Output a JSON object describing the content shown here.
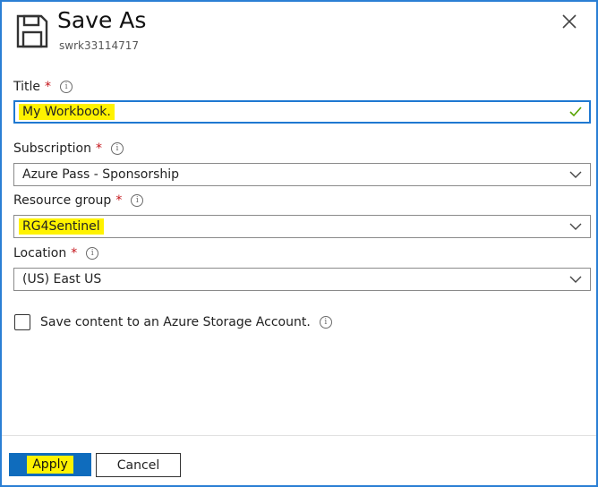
{
  "dialog": {
    "title": "Save As",
    "subtitle": "swrk33114717",
    "icons": {
      "header": "floppy-disk-icon",
      "close": "close-icon"
    }
  },
  "form": {
    "title_field": {
      "label": "Title",
      "required_mark": "*",
      "value": "My Workbook.",
      "valid": true
    },
    "subscription": {
      "label": "Subscription",
      "required_mark": "*",
      "selected": "Azure Pass - Sponsorship"
    },
    "resource_group": {
      "label": "Resource group",
      "required_mark": "*",
      "selected": "RG4Sentinel"
    },
    "location": {
      "label": "Location",
      "required_mark": "*",
      "selected": "(US) East US"
    },
    "storage_checkbox": {
      "label": "Save content to an Azure Storage Account.",
      "checked": false
    },
    "info_glyph": "i"
  },
  "footer": {
    "apply_label": "Apply",
    "cancel_label": "Cancel"
  },
  "colors": {
    "border_accent": "#2a7fd4",
    "primary_button": "#0f6cbd",
    "highlight": "#fff200",
    "required": "#c4141a",
    "valid_check": "#57a300"
  }
}
